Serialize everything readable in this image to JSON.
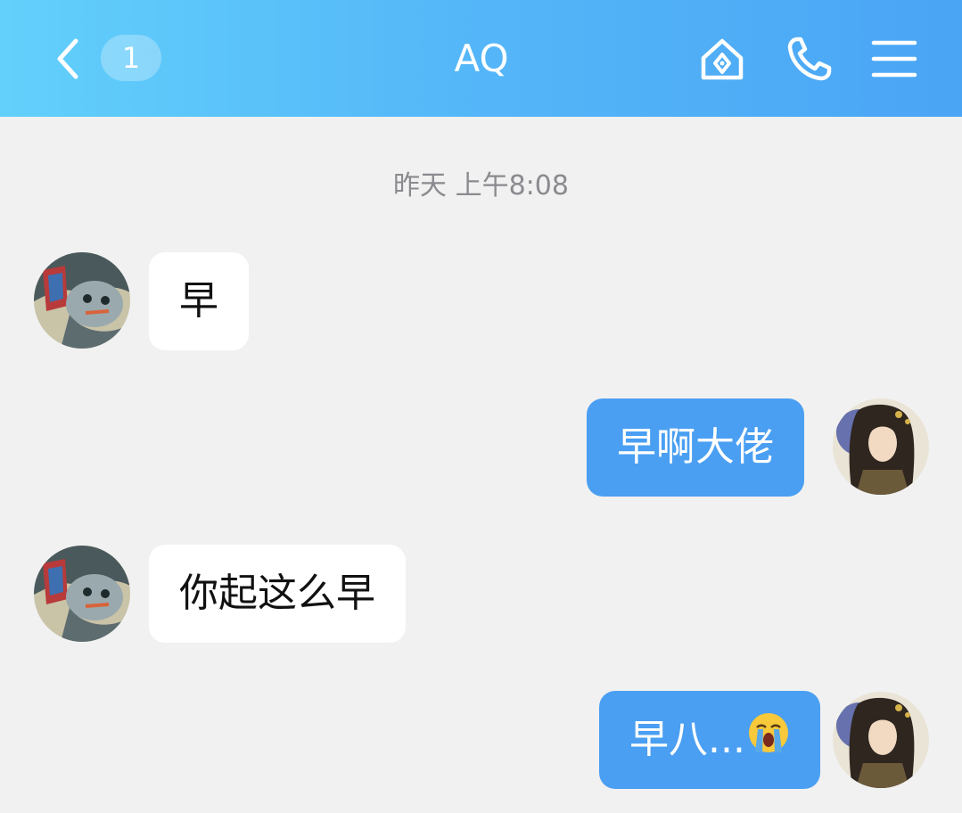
{
  "header": {
    "title": "AQ",
    "unread_count": "1",
    "icons": [
      "back-chevron-icon",
      "home-diamond-icon",
      "phone-icon",
      "menu-icon"
    ]
  },
  "timestamp": "昨天 上午8:08",
  "messages": [
    {
      "side": "in",
      "text": "早"
    },
    {
      "side": "out",
      "text": "早啊大佬"
    },
    {
      "side": "in",
      "text": "你起这么早"
    },
    {
      "side": "out",
      "text": "早八...",
      "emoji": "loudly-crying-face-emoji"
    }
  ],
  "colors": {
    "header_gradient_start": "#62d0fb",
    "header_gradient_end": "#4aa5f5",
    "outgoing_bubble": "#4a9ff2",
    "incoming_bubble": "#ffffff",
    "background": "#f1f1f1"
  }
}
